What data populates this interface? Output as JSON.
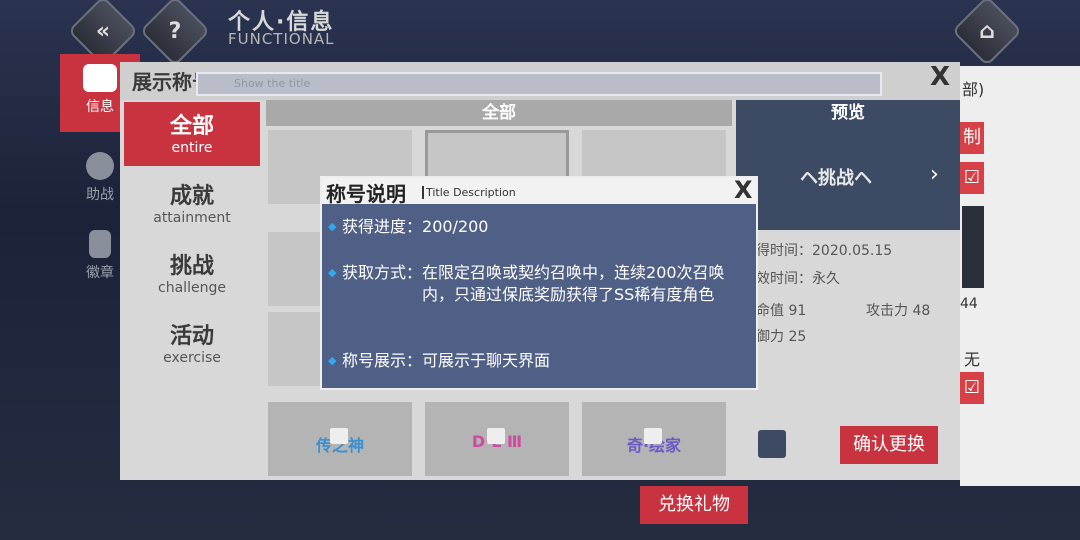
{
  "header": {
    "title": "个人·信息",
    "subtitle": "FUNCTIONAL",
    "back_icon": "chevrons-left-icon",
    "help_glyph": "?",
    "home_icon": "home-icon"
  },
  "side_nav": [
    {
      "label": "信息",
      "icon": "id-card-icon"
    },
    {
      "label": "助战",
      "icon": "heart-icon"
    },
    {
      "label": "徽章",
      "icon": "medal-icon"
    }
  ],
  "right_panel": {
    "tab_fragment": "部)",
    "btn_a": "制",
    "btn_b": "☑",
    "value_44": "44",
    "value_wu": "无",
    "edit_btn": "☑"
  },
  "title_panel": {
    "title": "展示称号",
    "subtitle": "Show the title",
    "close": "X"
  },
  "categories": [
    {
      "zh": "全部",
      "en": "entire"
    },
    {
      "zh": "成就",
      "en": "attainment"
    },
    {
      "zh": "挑战",
      "en": "challenge"
    },
    {
      "zh": "活动",
      "en": "exercise"
    }
  ],
  "grid": {
    "header": "全部",
    "tiles_bottom": [
      "传之神",
      "D·L Ⅲ",
      "奇·绘家"
    ]
  },
  "preview": {
    "header": "预览",
    "title": "ヘ挑战ヘ",
    "obtain_time": "得时间：2020.05.15",
    "valid_time": "效时间：永久",
    "hp": "命值 91",
    "atk": "攻击力 48",
    "def": "御力 25"
  },
  "buttons": {
    "confirm": "确认更换",
    "exchange": "兑换礼物"
  },
  "modal": {
    "title": "称号说明",
    "subtitle": "Title Description",
    "close": "X",
    "rows": [
      {
        "label": "获得进度：",
        "value": "200/200"
      },
      {
        "label": "获取方式：",
        "value": "在限定召唤或契约召唤中，连续200次召唤内，只通过保底奖励获得了SS稀有度角色"
      },
      {
        "label": "称号展示：",
        "value": "可展示于聊天界面"
      }
    ]
  },
  "colors": {
    "accent": "#c9323f",
    "modal_bg": "#4f5f86",
    "bullet": "#32a8f0"
  }
}
